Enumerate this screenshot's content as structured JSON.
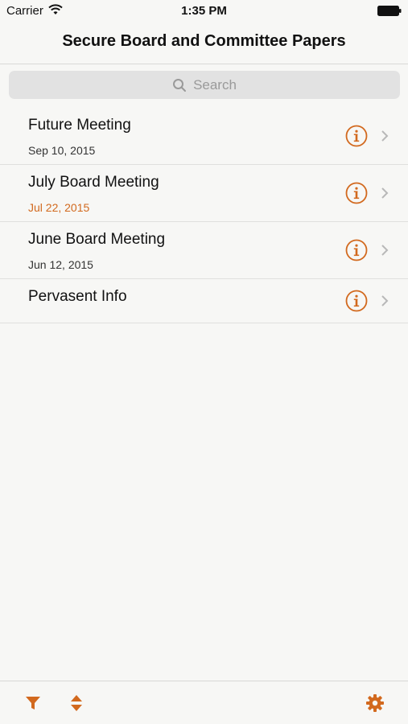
{
  "status": {
    "carrier": "Carrier",
    "time": "1:35 PM"
  },
  "nav": {
    "title": "Secure Board and Committee Papers"
  },
  "search": {
    "placeholder": "Search"
  },
  "items": [
    {
      "name": "Future Meeting",
      "date": "Sep 10, 2015"
    },
    {
      "name": "July Board Meeting",
      "date": "Jul 22, 2015"
    },
    {
      "name": "June Board Meeting",
      "date": "Jun 12, 2015"
    },
    {
      "name": "Pervasent Info"
    }
  ],
  "colors": {
    "accent": "#d2691e",
    "date_highlight": "#d2691e"
  },
  "icons": {
    "info": "info-circle-icon",
    "chevron": "chevron-right-icon",
    "filter": "filter-icon",
    "sort": "sort-icon",
    "settings": "gear-icon",
    "search": "search-icon"
  }
}
